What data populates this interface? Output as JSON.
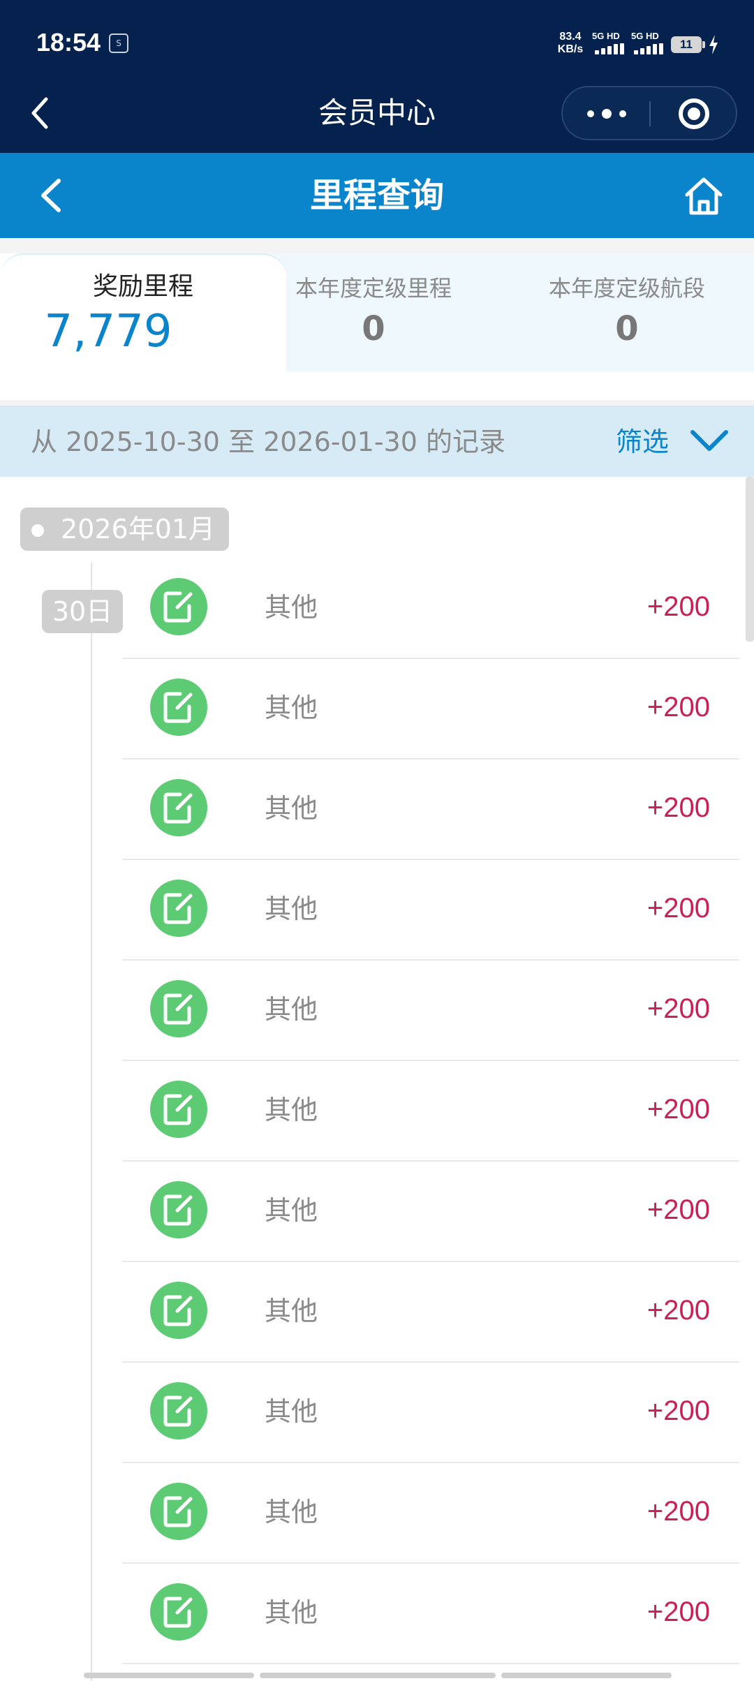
{
  "status_bar": {
    "time": "18:54",
    "app_icon_text": "Soul",
    "network_speed_value": "83.4",
    "network_speed_unit": "KB/s",
    "sim1_label": "5G HD",
    "sim2_label": "5G HD",
    "battery_level": "11"
  },
  "mini_program": {
    "title": "会员中心",
    "more_icon": "more-dots-icon",
    "close_icon": "target-circle-icon"
  },
  "page": {
    "title": "里程查询",
    "back_icon": "chevron-left-icon",
    "home_icon": "home-icon"
  },
  "tabs": [
    {
      "label": "奖励里程",
      "value": "7,779",
      "active": true
    },
    {
      "label": "本年度定级里程",
      "value": "0",
      "active": false
    },
    {
      "label": "本年度定级航段",
      "value": "0",
      "active": false
    }
  ],
  "filter": {
    "range_text": "从 2025-10-30 至 2026-01-30 的记录",
    "button_label": "筛选"
  },
  "records": {
    "month": "2026年01月",
    "day": "30日",
    "items": [
      {
        "type": "其他",
        "amount": "+200"
      },
      {
        "type": "其他",
        "amount": "+200"
      },
      {
        "type": "其他",
        "amount": "+200"
      },
      {
        "type": "其他",
        "amount": "+200"
      },
      {
        "type": "其他",
        "amount": "+200"
      },
      {
        "type": "其他",
        "amount": "+200"
      },
      {
        "type": "其他",
        "amount": "+200"
      },
      {
        "type": "其他",
        "amount": "+200"
      },
      {
        "type": "其他",
        "amount": "+200"
      },
      {
        "type": "其他",
        "amount": "+200"
      },
      {
        "type": "其他",
        "amount": "+200"
      }
    ]
  },
  "colors": {
    "header_dark": "#04224d",
    "page_nav_blue": "#0a85cc",
    "accent_blue": "#0a85cc",
    "filter_bar_bg": "#d6ebf6",
    "record_icon_green": "#5ccb74",
    "amount_red": "#cc1f54",
    "tag_gray": "#cfcfcf"
  }
}
